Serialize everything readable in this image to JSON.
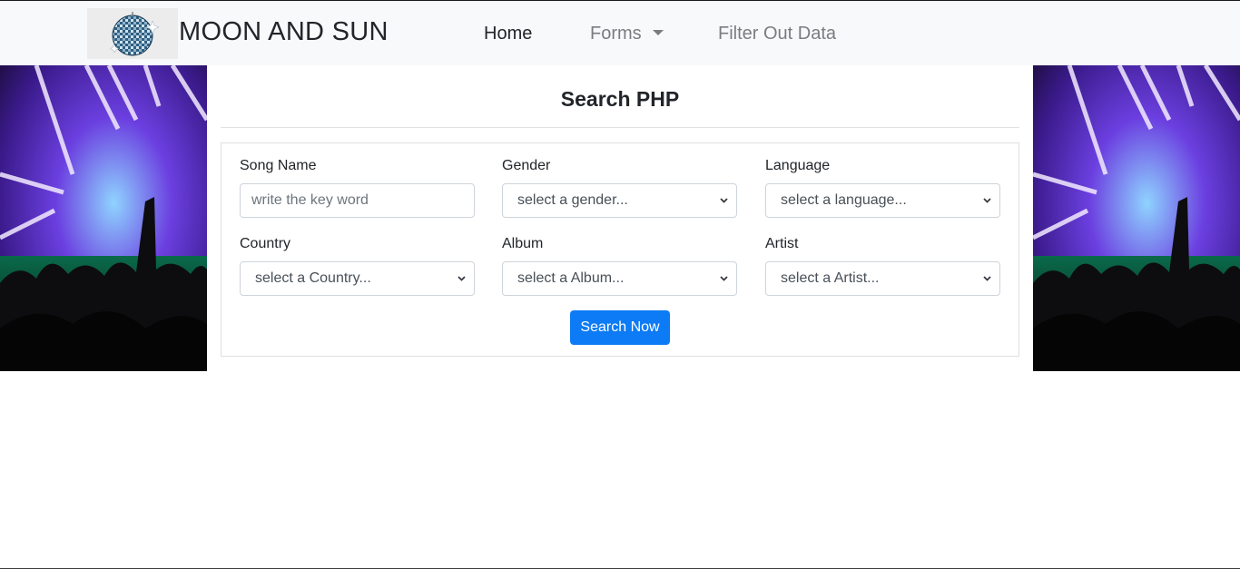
{
  "brand": {
    "name": "MOON AND SUN",
    "logo_icon": "disco-ball-icon"
  },
  "nav": {
    "home": "Home",
    "forms": "Forms",
    "filter": "Filter Out Data"
  },
  "page": {
    "title": "Search PHP"
  },
  "form": {
    "song_name": {
      "label": "Song Name",
      "placeholder": "write the key word"
    },
    "gender": {
      "label": "Gender",
      "selected": "select a gender..."
    },
    "language": {
      "label": "Language",
      "selected": "select a language..."
    },
    "country": {
      "label": "Country",
      "selected": "select a Country..."
    },
    "album": {
      "label": "Album",
      "selected": "select a Album..."
    },
    "artist": {
      "label": "Artist",
      "selected": "select a Artist..."
    },
    "submit": "Search Now"
  },
  "colors": {
    "primary": "#0d7bf5",
    "navbar_bg": "#f8f9fa"
  }
}
